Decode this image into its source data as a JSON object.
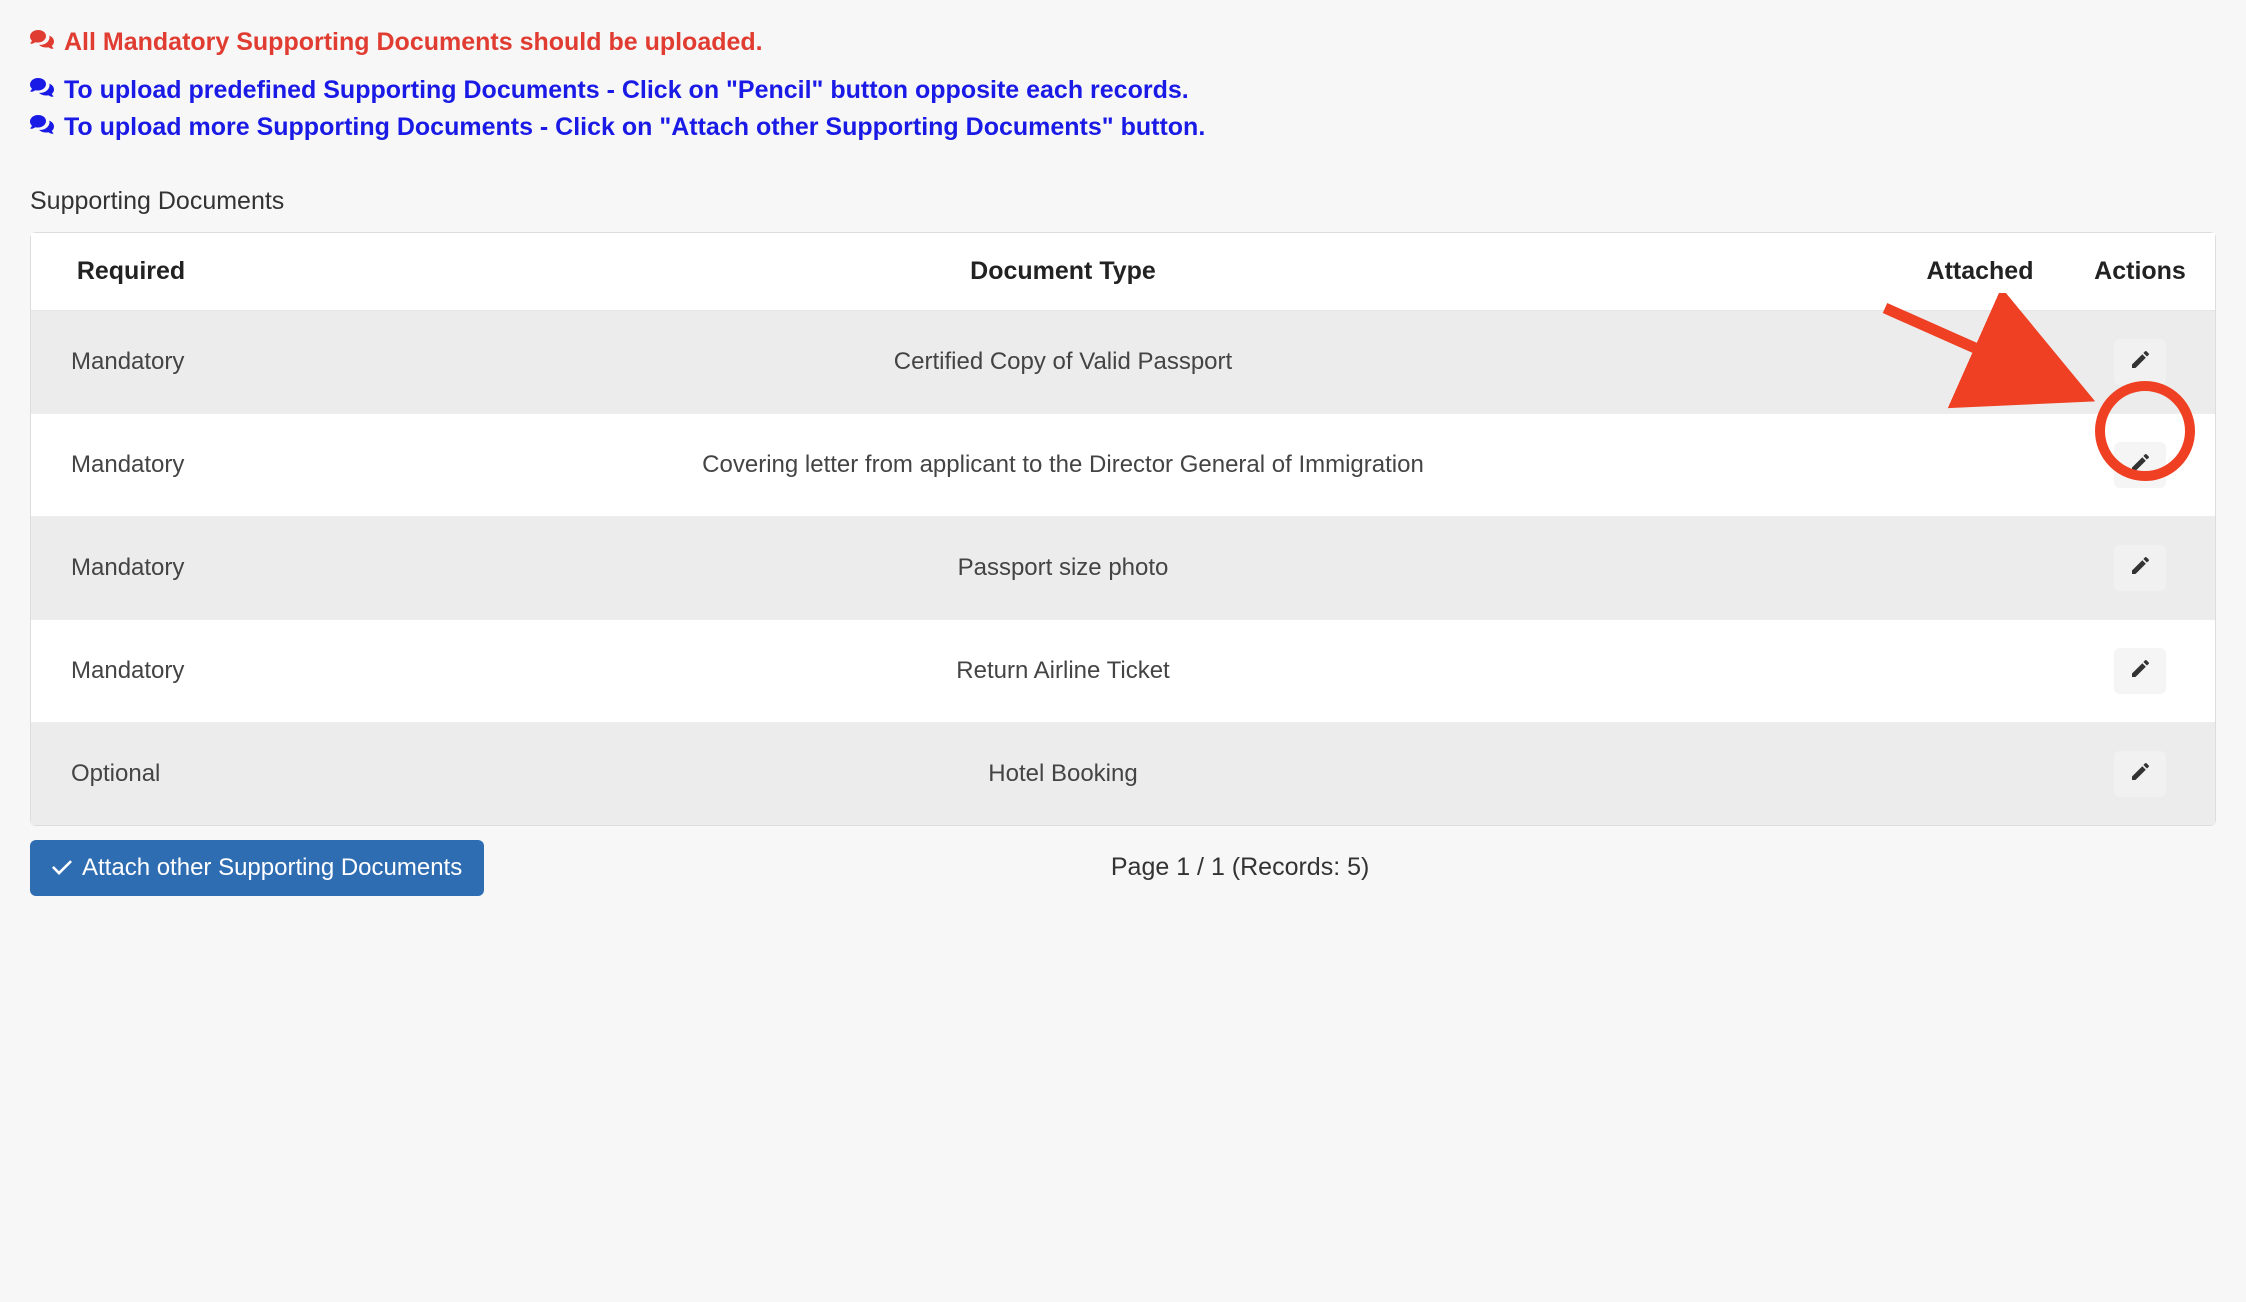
{
  "instructions": {
    "line1": "All Mandatory Supporting Documents should be uploaded.",
    "line2": "To upload predefined Supporting Documents - Click on \"Pencil\" button opposite each records.",
    "line3": "To upload more Supporting Documents - Click on \"Attach other Supporting Documents\" button."
  },
  "section_title": "Supporting Documents",
  "table": {
    "headers": {
      "required": "Required",
      "type": "Document Type",
      "attached": "Attached",
      "actions": "Actions"
    },
    "rows": [
      {
        "required": "Mandatory",
        "type": "Certified Copy of Valid Passport",
        "attached": ""
      },
      {
        "required": "Mandatory",
        "type": "Covering letter from applicant to the Director General of Immigration",
        "attached": ""
      },
      {
        "required": "Mandatory",
        "type": "Passport size photo",
        "attached": ""
      },
      {
        "required": "Mandatory",
        "type": "Return Airline Ticket",
        "attached": ""
      },
      {
        "required": "Optional",
        "type": "Hotel Booking",
        "attached": ""
      }
    ]
  },
  "footer": {
    "attach_button": "Attach other Supporting Documents",
    "pagination": "Page 1 / 1 (Records: 5)"
  },
  "colors": {
    "red": "#e03c31",
    "blue": "#1a1ae6",
    "primary_btn": "#2f6db3",
    "annotation": "#ef4023"
  },
  "annotation": {
    "highlights_row_index": 1,
    "shape": "circle-with-arrow",
    "target": "edit-button"
  }
}
